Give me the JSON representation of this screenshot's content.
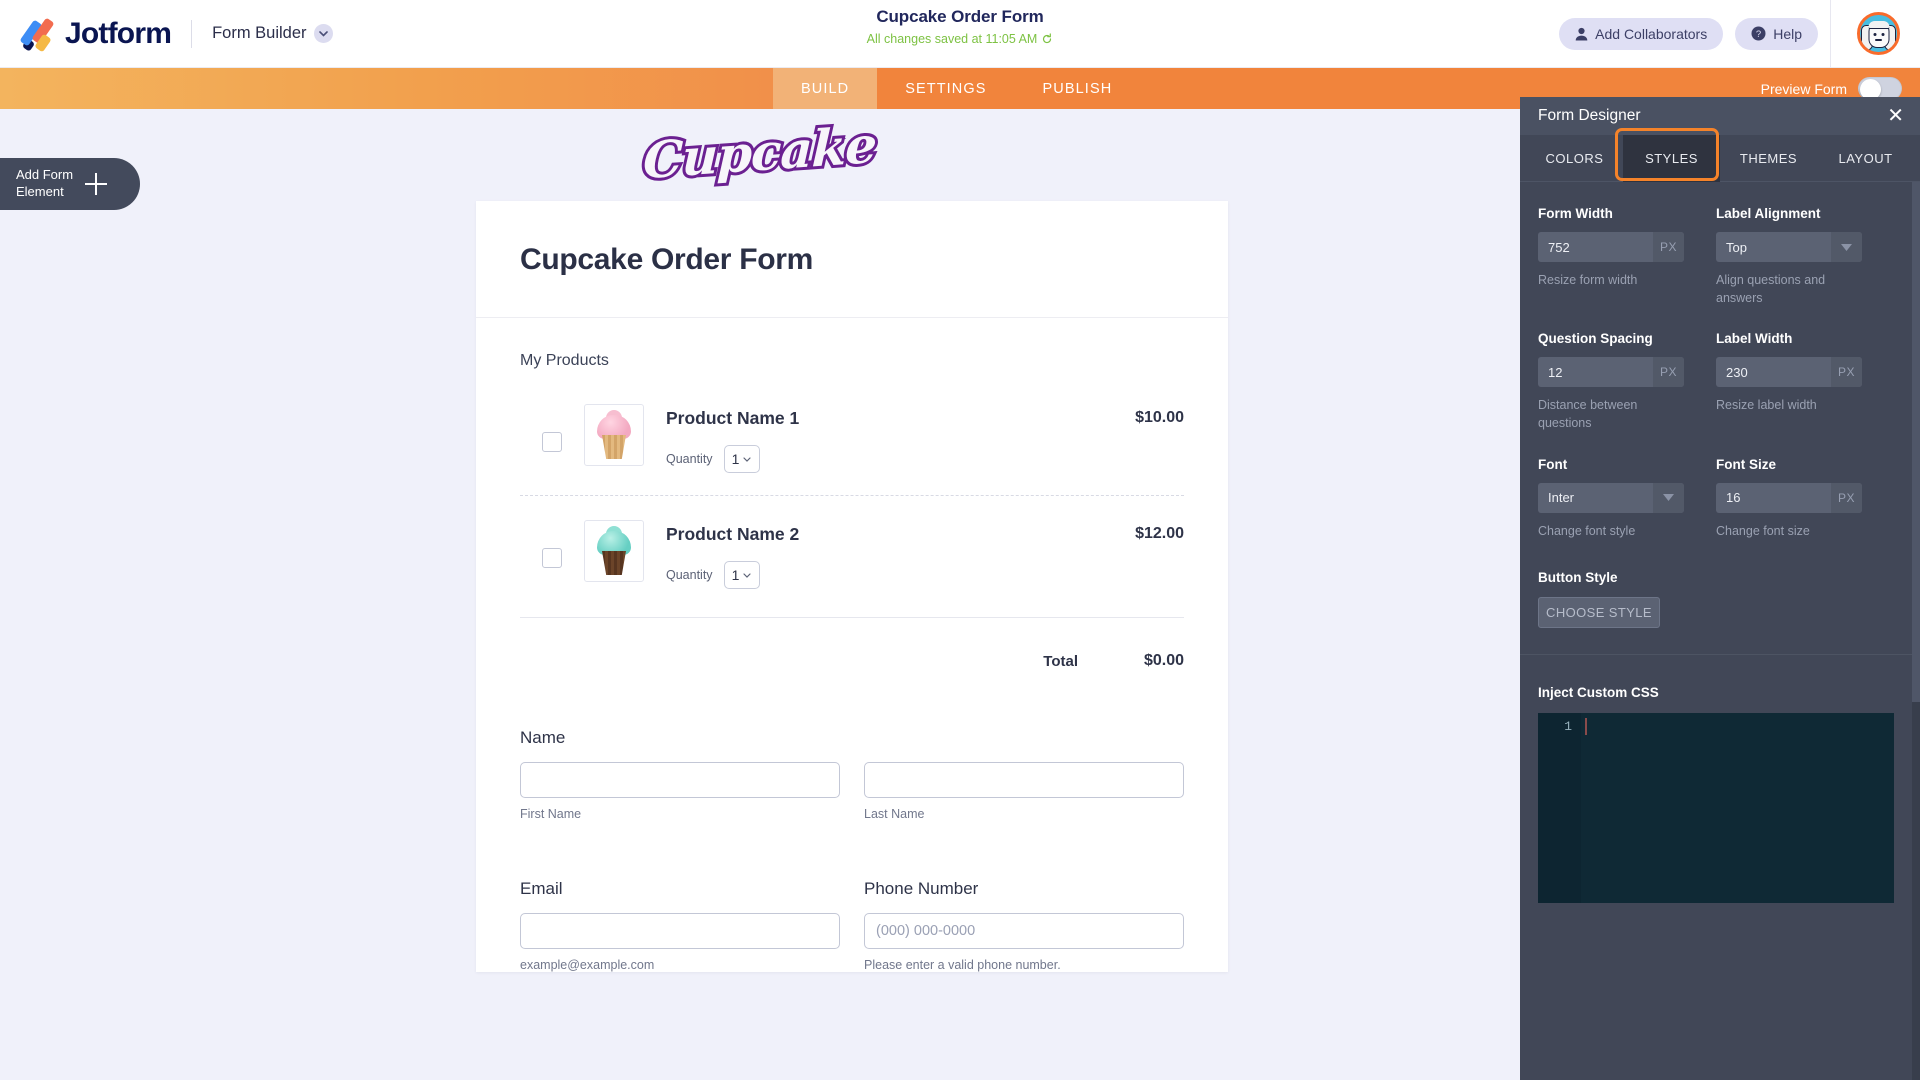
{
  "header": {
    "brand_name": "Jotform",
    "product_menu": "Form Builder",
    "form_title": "Cupcake Order Form",
    "save_status": "All changes saved at 11:05 AM",
    "add_collaborators": "Add Collaborators",
    "help": "Help"
  },
  "nav": {
    "tabs": [
      {
        "label": "BUILD",
        "active": true
      },
      {
        "label": "SETTINGS",
        "active": false
      },
      {
        "label": "PUBLISH",
        "active": false
      }
    ],
    "preview_label": "Preview Form",
    "preview_enabled": false
  },
  "canvas": {
    "add_element_line1": "Add Form",
    "add_element_line2": "Element",
    "logo_text": "Cupcake",
    "form_title": "Cupcake Order Form",
    "products_heading": "My Products",
    "products": [
      {
        "name": "Product Name 1",
        "price": "$10.00",
        "quantity_label": "Quantity",
        "quantity_value": "1",
        "thumb": "pink-cupcake-thumbnail"
      },
      {
        "name": "Product Name 2",
        "price": "$12.00",
        "quantity_label": "Quantity",
        "quantity_value": "1",
        "thumb": "teal-cupcake-thumbnail"
      }
    ],
    "total_label": "Total",
    "total_value": "$0.00",
    "name_field": {
      "label": "Name",
      "first_value": "",
      "first_placeholder": "",
      "first_sub": "First Name",
      "last_value": "",
      "last_placeholder": "",
      "last_sub": "Last Name"
    },
    "email_field": {
      "label": "Email",
      "value": "",
      "placeholder": "",
      "sub": "example@example.com"
    },
    "phone_field": {
      "label": "Phone Number",
      "value": "",
      "placeholder": "(000) 000-0000",
      "sub": "Please enter a valid phone number."
    }
  },
  "designer": {
    "title": "Form Designer",
    "tabs": [
      {
        "label": "COLORS",
        "selected": false
      },
      {
        "label": "STYLES",
        "selected": true
      },
      {
        "label": "THEMES",
        "selected": false
      },
      {
        "label": "LAYOUT",
        "selected": false
      }
    ],
    "form_width": {
      "label": "Form Width",
      "value": "752",
      "unit": "PX",
      "hint": "Resize form width"
    },
    "label_alignment": {
      "label": "Label Alignment",
      "value": "Top",
      "hint": "Align questions and answers"
    },
    "question_spacing": {
      "label": "Question Spacing",
      "value": "12",
      "unit": "PX",
      "hint": "Distance between questions"
    },
    "label_width": {
      "label": "Label Width",
      "value": "230",
      "unit": "PX",
      "hint": "Resize label width"
    },
    "font": {
      "label": "Font",
      "value": "Inter",
      "hint": "Change font style"
    },
    "font_size": {
      "label": "Font Size",
      "value": "16",
      "unit": "PX",
      "hint": "Change font size"
    },
    "button_style": {
      "label": "Button Style",
      "button": "CHOOSE STYLE"
    },
    "custom_css": {
      "label": "Inject Custom CSS",
      "line_number": "1",
      "content": ""
    }
  },
  "colors": {
    "brand_navy": "#0a1551",
    "accent_orange": "#f1843c",
    "highlight_orange": "#f5832a",
    "saved_green": "#7dc243",
    "panel_bg": "#414757",
    "canvas_bg": "#f0f1fa",
    "logo_purple": "#6b2091"
  }
}
